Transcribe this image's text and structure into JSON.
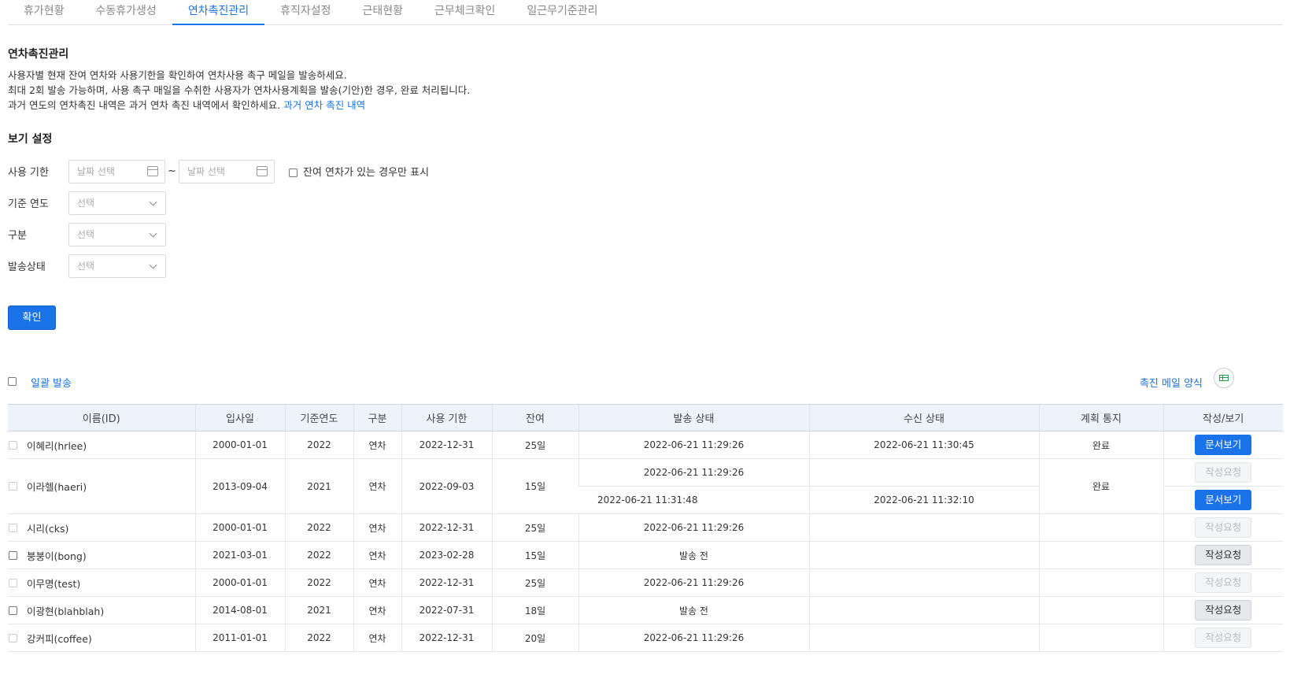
{
  "tabs": [
    {
      "label": "휴가현황",
      "active": false
    },
    {
      "label": "수동휴가생성",
      "active": false
    },
    {
      "label": "연차촉진관리",
      "active": true
    },
    {
      "label": "휴직자설정",
      "active": false
    },
    {
      "label": "근태현황",
      "active": false
    },
    {
      "label": "근무체크확인",
      "active": false
    },
    {
      "label": "일근무기준관리",
      "active": false
    }
  ],
  "intro": {
    "title": "연차촉진관리",
    "line1": "사용자별 현재 잔여 연차와 사용기한을 확인하여 연차사용 촉구 메일을 발송하세요.",
    "line2": "최대 2회 발송 가능하며, 사용 촉구 매일을 수취한 사용자가 연차사용계획을 발송(기안)한 경우, 완료 처리됩니다.",
    "line3": "과거 연도의 연차촉진 내역은 과거 연차 촉진 내역에서 확인하세요.",
    "link": "과거 연차 촉진 내역"
  },
  "filters": {
    "title": "보기 설정",
    "period_label": "사용 기한",
    "date_placeholder": "날짜 선택",
    "tilde": "~",
    "remaining_only_label": "잔여 연차가 있는 경우만 표시",
    "year_label": "기준 연도",
    "type_label": "구분",
    "status_label": "발송상태",
    "select_placeholder": "선택",
    "confirm_button": "확인"
  },
  "toolbar": {
    "bulk_send": "일괄 발송",
    "mail_template": "촉진 메일 양식",
    "excel_icon": "excel-sheet-icon"
  },
  "table": {
    "headers": [
      "이름(ID)",
      "입사일",
      "기준연도",
      "구분",
      "사용 기한",
      "잔여",
      "발송 상태",
      "수신 상태",
      "계획 통지",
      "작성/보기"
    ],
    "rows": [
      {
        "name": "이혜리(hrlee)",
        "hire": "2000-01-01",
        "year": "2022",
        "type": "연차",
        "deadline": "2022-12-31",
        "remain": "25일",
        "sent": "2022-06-21 11:29:26",
        "received": "2022-06-21 11:30:45",
        "plan": "완료",
        "action": "문서보기"
      },
      {
        "name": "이라헬(haeri)",
        "hire": "2013-09-04",
        "year": "2021",
        "type": "연차",
        "deadline": "2022-09-03",
        "remain": "15일",
        "sent": "2022-06-21 11:29:26",
        "received": "",
        "plan": "완료",
        "action": "작성요청",
        "sent2": "2022-06-21 11:31:48",
        "received2": "2022-06-21 11:32:10",
        "action2": "문서보기"
      },
      {
        "name": "시리(cks)",
        "hire": "2000-01-01",
        "year": "2022",
        "type": "연차",
        "deadline": "2022-12-31",
        "remain": "25일",
        "sent": "2022-06-21 11:29:26",
        "received": "",
        "plan": "",
        "action": "작성요청"
      },
      {
        "name": "붕붕이(bong)",
        "hire": "2021-03-01",
        "year": "2022",
        "type": "연차",
        "deadline": "2023-02-28",
        "remain": "15일",
        "sent": "발송 전",
        "received": "",
        "plan": "",
        "action": "작성요청"
      },
      {
        "name": "이무명(test)",
        "hire": "2000-01-01",
        "year": "2022",
        "type": "연차",
        "deadline": "2022-12-31",
        "remain": "25일",
        "sent": "2022-06-21 11:29:26",
        "received": "",
        "plan": "",
        "action": "작성요청"
      },
      {
        "name": "이광현(blahblah)",
        "hire": "2014-08-01",
        "year": "2021",
        "type": "연차",
        "deadline": "2022-07-31",
        "remain": "18일",
        "sent": "발송 전",
        "received": "",
        "plan": "",
        "action": "작성요청"
      },
      {
        "name": "강커피(coffee)",
        "hire": "2011-01-01",
        "year": "2022",
        "type": "연차",
        "deadline": "2022-12-31",
        "remain": "20일",
        "sent": "2022-06-21 11:29:26",
        "received": "",
        "plan": "",
        "action": "작성요청"
      }
    ]
  },
  "colors": {
    "accent": "#1a73e8",
    "header_bg": "#eef3fb"
  }
}
